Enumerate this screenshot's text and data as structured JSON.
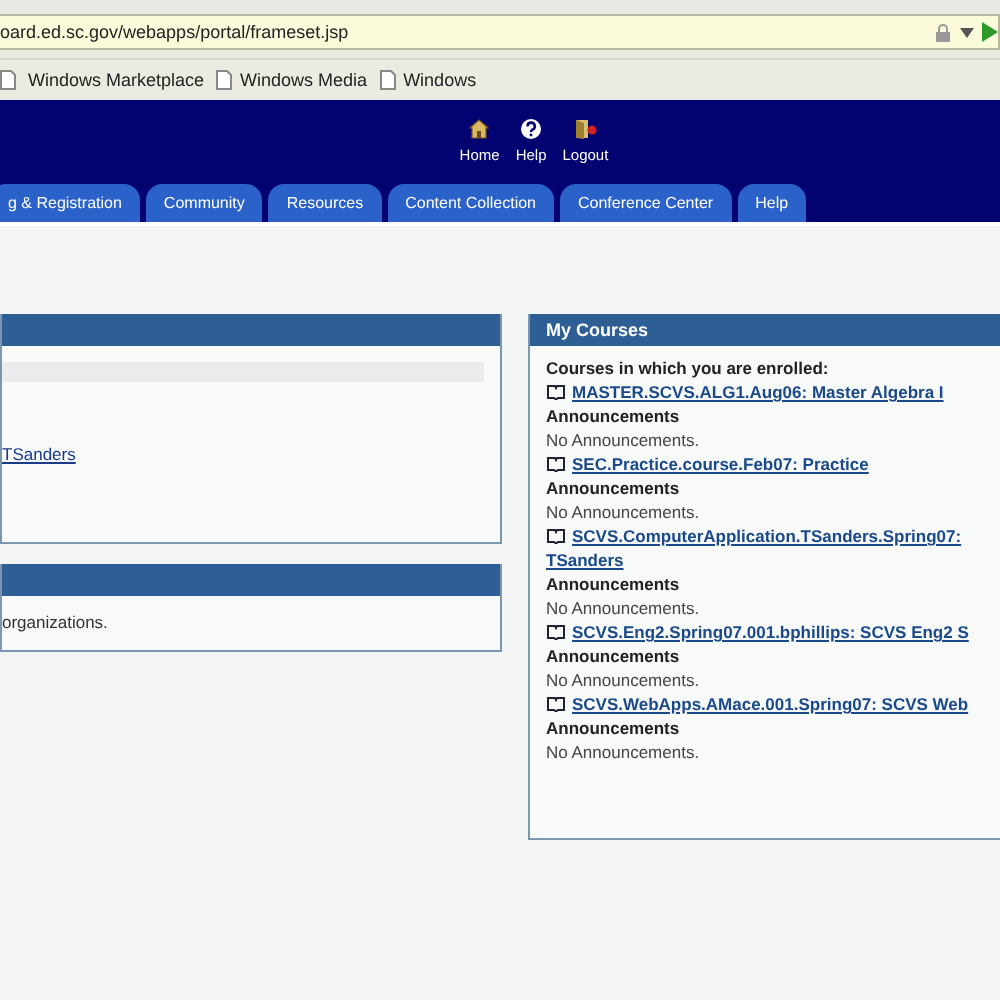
{
  "address_bar": {
    "url": "oard.ed.sc.gov/webapps/portal/frameset.jsp"
  },
  "bookmarks": [
    "Windows Marketplace",
    "Windows Media",
    "Windows"
  ],
  "header_links": [
    {
      "label": "Home",
      "kind": "home"
    },
    {
      "label": "Help",
      "kind": "help"
    },
    {
      "label": "Logout",
      "kind": "logout"
    }
  ],
  "tabs": [
    {
      "label": "g & Registration",
      "selected": false
    },
    {
      "label": "Community",
      "selected": false
    },
    {
      "label": "Resources",
      "selected": false
    },
    {
      "label": "Content Collection",
      "selected": false
    },
    {
      "label": "Conference Center",
      "selected": false
    },
    {
      "label": "Help",
      "selected": false
    }
  ],
  "left_panels": [
    {
      "link": "TSanders"
    },
    {
      "text": "organizations."
    }
  ],
  "my_courses": {
    "title": "My Courses",
    "intro": "Courses in which you are enrolled:",
    "courses": [
      {
        "title": "MASTER.SCVS.ALG1.Aug06: Master Algebra I",
        "heading": "Announcements",
        "note": "No Announcements."
      },
      {
        "title": "SEC.Practice.course.Feb07: Practice",
        "heading": "Announcements",
        "note": "No Announcements."
      },
      {
        "title": "SCVS.ComputerApplication.TSanders.Spring07:",
        "title_continued": "TSanders",
        "heading": "Announcements",
        "note": "No Announcements."
      },
      {
        "title": "SCVS.Eng2.Spring07.001.bphillips: SCVS Eng2 S",
        "heading": "Announcements",
        "note": "No Announcements."
      },
      {
        "title": "SCVS.WebApps.AMace.001.Spring07: SCVS Web",
        "heading": "Announcements",
        "note": "No Announcements."
      }
    ]
  }
}
